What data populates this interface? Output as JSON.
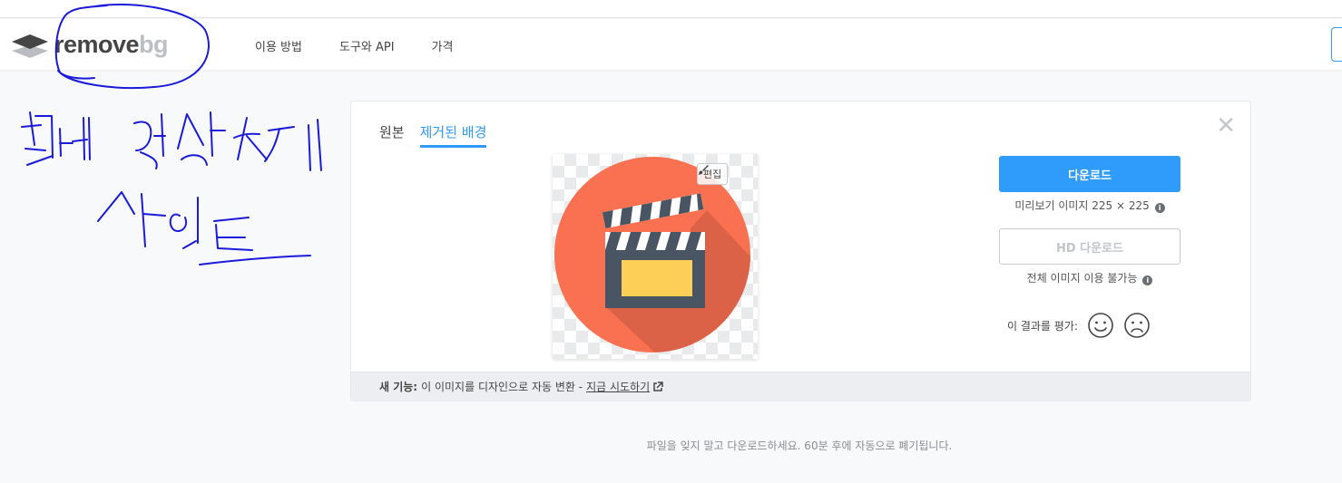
{
  "nav": {
    "logo_word1": "remove",
    "logo_word2": "bg",
    "links": [
      "이용 방법",
      "도구와 API",
      "가격"
    ]
  },
  "card": {
    "tabs": [
      "원본",
      "제거된 배경"
    ],
    "active_tab": "제거된 배경",
    "close_symbol": "✕",
    "edit_label": "편집",
    "download_label": "다운로드",
    "download_caption": "미리보기 이미지 225 × 225",
    "hd_download_label": "HD 다운로드",
    "hd_caption": "전체 이미지 이용 불가능",
    "rate_label": "이 결과를 평가:",
    "footer_bold": "새 기능:",
    "footer_text": "이 이미지를 디자인으로 자동 변환 -",
    "footer_link": "지금 시도하기"
  },
  "bottom_note": "파일을 잊지 말고 다운로드하세요. 60분 후에 자동으로 폐기됩니다.",
  "colors": {
    "accent": "#2f9bfb",
    "annotation_ink": "#1a1adb",
    "clip_circle": "#f97150",
    "clapper_body": "#4a5563",
    "clapper_screen": "#fdcf56"
  },
  "icons": [
    "logo-layers-icon",
    "close-icon",
    "brush-icon",
    "info-icon",
    "smile-icon",
    "frown-icon",
    "external-link-icon",
    "clapperboard-icon"
  ]
}
